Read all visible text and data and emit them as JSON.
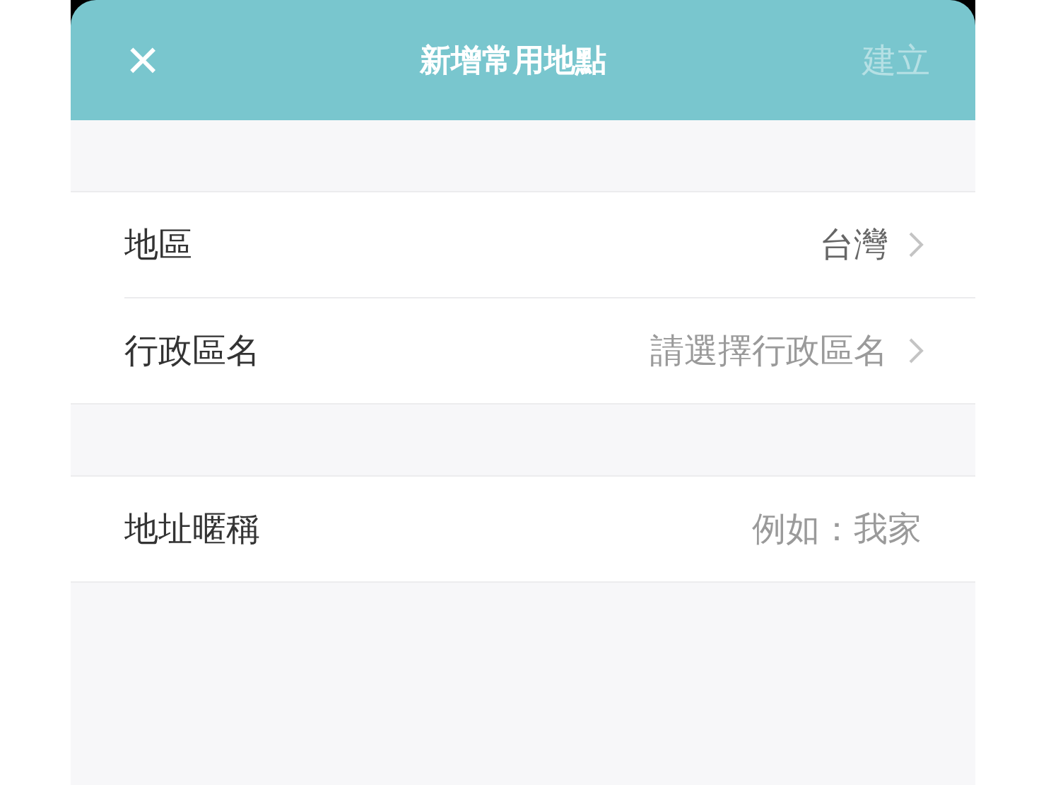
{
  "header": {
    "close": "×",
    "title": "新增常用地點",
    "action": {
      "label": "建立",
      "disabled": true
    }
  },
  "sections": [
    {
      "rows": [
        {
          "kind": "select",
          "label": "地區",
          "value": "台灣"
        },
        {
          "kind": "select",
          "label": "行政區名",
          "placeholder": "請選擇行政區名"
        }
      ]
    },
    {
      "rows": [
        {
          "kind": "input",
          "label": "地址暱稱",
          "placeholder": "例如：我家"
        }
      ]
    }
  ]
}
